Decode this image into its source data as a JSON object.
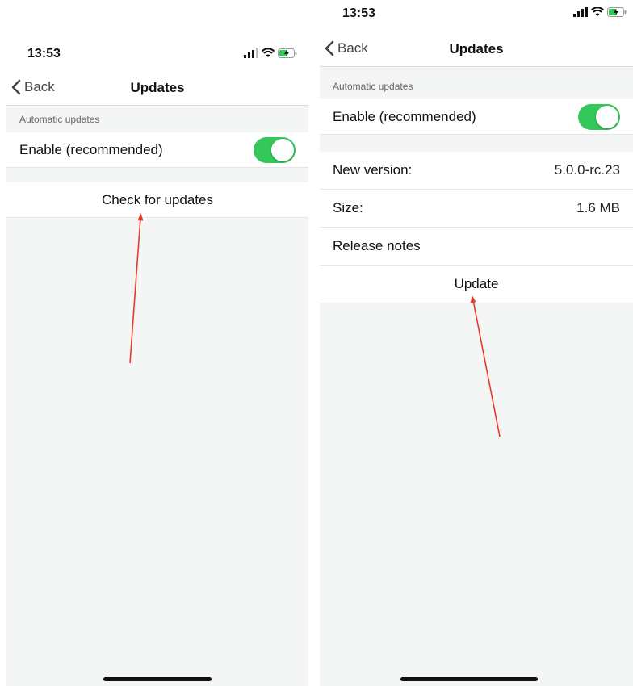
{
  "colors": {
    "toggle_on": "#34c759",
    "arrow": "#e8392b",
    "background": "#f4f5f5"
  },
  "icons": {
    "signal": "signal-bars-icon",
    "wifi": "wifi-icon",
    "battery": "battery-charging-icon",
    "back": "chevron-left-icon"
  },
  "left": {
    "status": {
      "time": "13:53"
    },
    "nav": {
      "back_label": "Back",
      "title": "Updates"
    },
    "section_header": "Automatic updates",
    "enable_label": "Enable (recommended)",
    "enabled": true,
    "check_button": "Check for updates"
  },
  "right": {
    "status": {
      "time": "13:53"
    },
    "nav": {
      "back_label": "Back",
      "title": "Updates"
    },
    "section_header": "Automatic updates",
    "enable_label": "Enable (recommended)",
    "enabled": true,
    "info_rows": [
      {
        "label": "New version:",
        "value": "5.0.0-rc.23"
      },
      {
        "label": "Size:",
        "value": "1.6 MB"
      }
    ],
    "release_notes": "Release notes",
    "update_button": "Update"
  }
}
